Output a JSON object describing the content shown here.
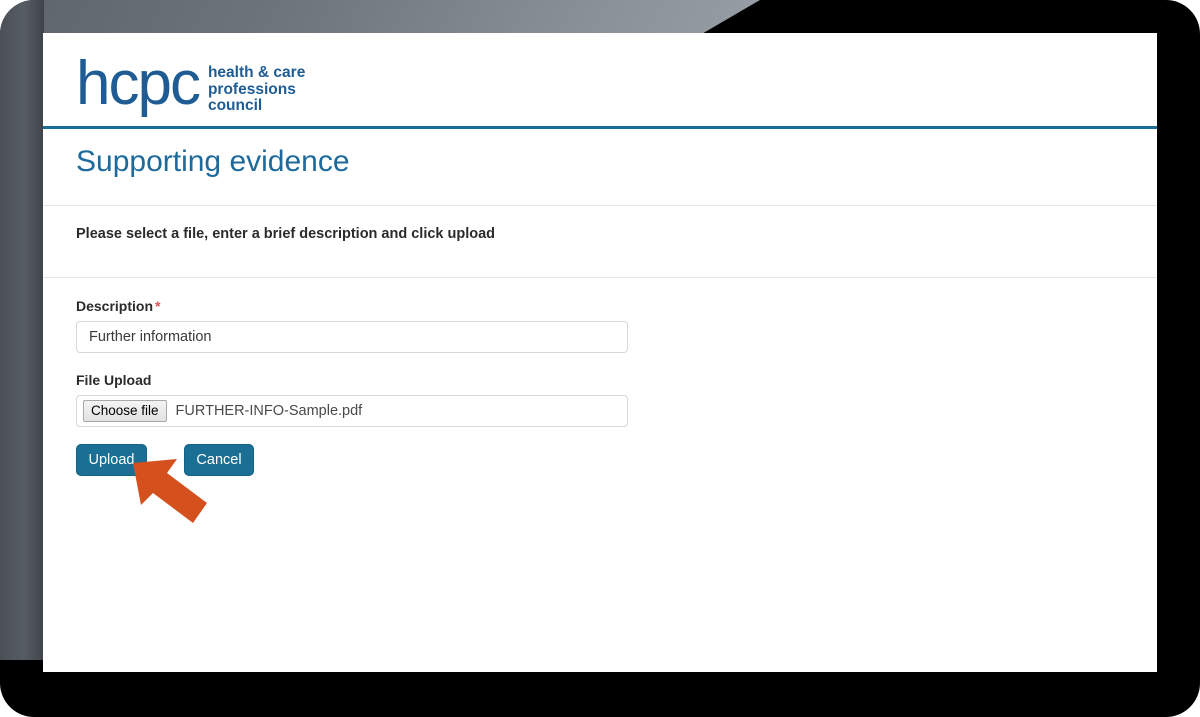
{
  "brand": {
    "logo_word": "hcpc",
    "logo_tagline_line1": "health & care",
    "logo_tagline_line2": "professions",
    "logo_tagline_line3": "council",
    "logo_color": "#1f5c93",
    "rule_color": "#1d6e95"
  },
  "page": {
    "title": "Supporting evidence",
    "title_color": "#1e6a9a",
    "instruction": "Please select a file, enter a brief description and click upload"
  },
  "form": {
    "description": {
      "label": "Description",
      "required_marker": "*",
      "required_color": "#d9534f",
      "value": "Further information",
      "placeholder": "Further information"
    },
    "file_upload": {
      "label": "File Upload",
      "choose_button_label": "Choose file",
      "file_name": "FURTHER-INFO-Sample.pdf"
    }
  },
  "actions": {
    "upload_label": "Upload",
    "cancel_label": "Cancel",
    "button_color": "#1b6f94"
  },
  "annotation": {
    "arrow_color": "#d4511e",
    "arrow_points_at": "Upload"
  }
}
